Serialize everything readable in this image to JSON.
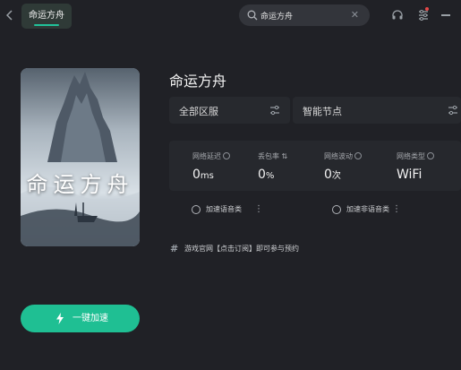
{
  "titlebar": {
    "back_icon": "chevron-left-icon",
    "tab_label": "命运方舟",
    "search": {
      "value": "命运方舟",
      "placeholder": ""
    },
    "icons": [
      "headset-icon",
      "list-settings-icon",
      "minimize-icon"
    ]
  },
  "game": {
    "title": "命运方舟",
    "cover_title": "命运方舟"
  },
  "selectors": {
    "region": "全部区服",
    "node": "智能节点"
  },
  "stats": [
    {
      "label": "网络延迟",
      "value": "0",
      "unit": "ms"
    },
    {
      "label": "丢包率",
      "value": "0",
      "unit": "%"
    },
    {
      "label": "网络波动",
      "value": "0",
      "unit": "次"
    },
    {
      "label": "网络类型",
      "value": "WiFi",
      "unit": ""
    }
  ],
  "options": {
    "voice": "加速语音类",
    "non_voice": "加速非语音类"
  },
  "notice": "游戏官网【点击订阅】即可参与预约",
  "accelerate_button": "一键加速",
  "colors": {
    "accent": "#1fbf93",
    "background": "#202126",
    "panel": "#26282d"
  }
}
